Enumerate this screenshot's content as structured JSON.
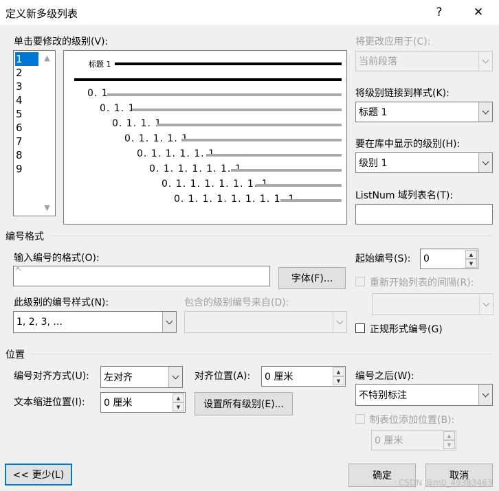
{
  "dialog": {
    "title": "定义新多级列表",
    "help": "?",
    "close": "✕"
  },
  "level_section": {
    "label": "单击要修改的级别(V):",
    "levels": [
      "1",
      "2",
      "3",
      "4",
      "5",
      "6",
      "7",
      "8",
      "9"
    ],
    "selected_level": "1"
  },
  "preview": {
    "heading_label": "标题 1",
    "rows": [
      "0. 1",
      "0. 1. 1",
      "0. 1. 1. 1",
      "0. 1. 1. 1. 1",
      "0. 1. 1. 1. 1. 1",
      "0. 1. 1. 1. 1. 1. 1",
      "0. 1. 1. 1. 1. 1. 1. 1",
      "0. 1. 1. 1. 1. 1. 1. 1. 1"
    ]
  },
  "right_panel": {
    "apply_to_label": "将更改应用于(C):",
    "apply_to_value": "当前段落",
    "link_style_label": "将级别链接到样式(K):",
    "link_style_value": "标题 1",
    "gallery_level_label": "要在库中显示的级别(H):",
    "gallery_level_value": "级别 1",
    "listnum_label": "ListNum 域列表名(T):",
    "listnum_value": ""
  },
  "number_format": {
    "section_label": "编号格式",
    "format_label": "输入编号的格式(O):",
    "format_value": "",
    "font_button": "字体(F)...",
    "style_label": "此级别的编号样式(N):",
    "style_value": "1, 2, 3, ...",
    "include_from_label": "包含的级别编号来自(D):",
    "include_from_value": "",
    "start_at_label": "起始编号(S):",
    "start_at_value": "0",
    "restart_label": "重新开始列表的间隔(R):",
    "restart_value": "",
    "legal_label": "正规形式编号(G)"
  },
  "position": {
    "section_label": "位置",
    "alignment_label": "编号对齐方式(U):",
    "alignment_value": "左对齐",
    "aligned_at_label": "对齐位置(A):",
    "aligned_at_value": "0 厘米",
    "indent_label": "文本缩进位置(I):",
    "indent_value": "0 厘米",
    "set_all_button": "设置所有级别(E)...",
    "follow_label": "编号之后(W):",
    "follow_value": "不特别标注",
    "tab_stop_label": "制表位添加位置(B):",
    "tab_stop_value": "0 厘米"
  },
  "footer": {
    "less_button": "<< 更少(L)",
    "ok_button": "确定",
    "cancel_button": "取消",
    "watermark": "CSDN @m0_49383463"
  }
}
